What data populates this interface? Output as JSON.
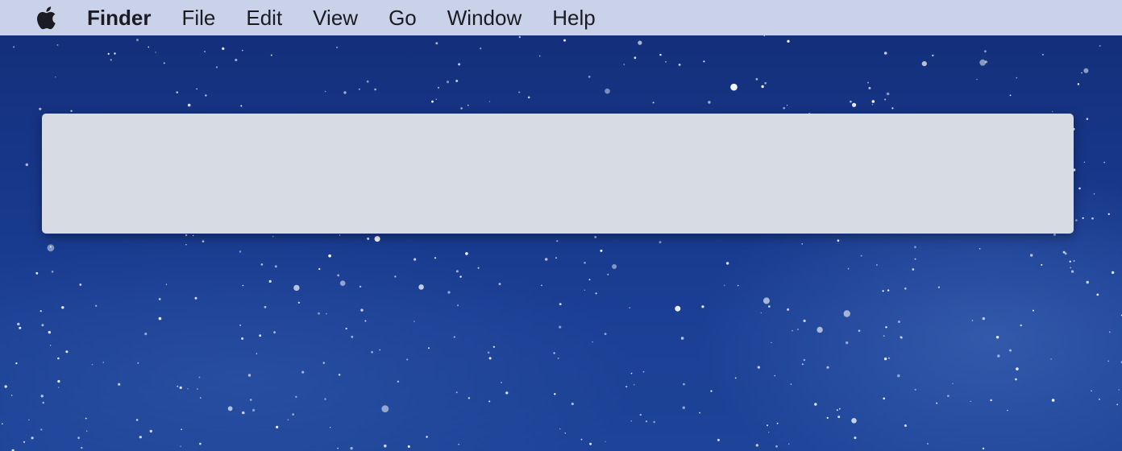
{
  "menubar": {
    "apple_icon": "apple-logo-icon",
    "app_name": "Finder",
    "items": [
      "File",
      "Edit",
      "View",
      "Go",
      "Window",
      "Help"
    ]
  },
  "desktop": {
    "wallpaper": "starry-night-sky",
    "colors": {
      "sky_dark": "#132e77",
      "sky_light": "#1d4498",
      "menubar_bg": "#c9d2e8",
      "panel_bg": "#d7dbe3"
    }
  }
}
